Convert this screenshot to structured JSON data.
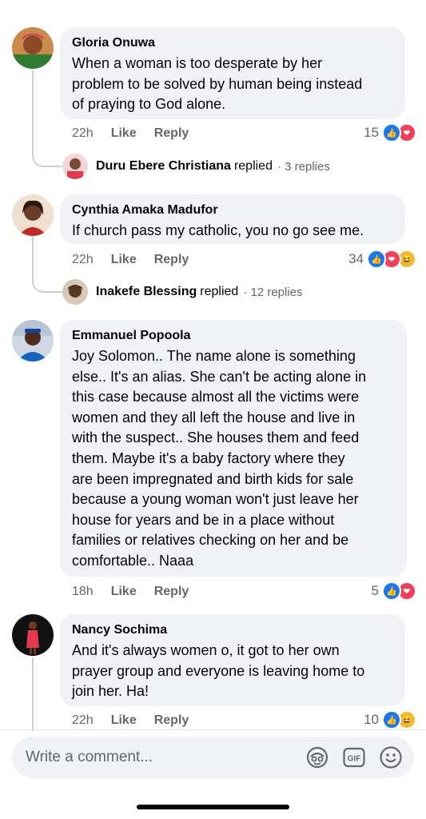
{
  "comments": [
    {
      "author": "Gloria Onuwa",
      "text": "When a woman is too desperate by her\nproblem to be solved by human being instead\nof praying to God alone.",
      "time": "22h",
      "like_label": "Like",
      "reply_label": "Reply",
      "reaction_count": "15",
      "reactions": [
        "like",
        "love"
      ],
      "reply_summary": {
        "name": "Duru Ebere Christiana",
        "verb": "replied",
        "count": "· 3 replies"
      }
    },
    {
      "author": "Cynthia Amaka Madufor",
      "text": "If church pass my catholic, you no go see me.",
      "time": "22h",
      "like_label": "Like",
      "reply_label": "Reply",
      "reaction_count": "34",
      "reactions": [
        "like",
        "love",
        "haha"
      ],
      "reply_summary": {
        "name": "Inakefe Blessing",
        "verb": "replied",
        "count": "· 12 replies"
      }
    },
    {
      "author": "Emmanuel Popoola",
      "text": "Joy Solomon.. The name alone is something\nelse.. It's an alias. She can't be acting alone in\nthis case because almost all the victims were\nwomen and they all left the house and live in\nwith the suspect.. She houses them and feed\nthem. Maybe it's a baby factory where they\nare been impregnated and birth kids for sale\nbecause a young woman won't just leave her\nhouse for years and be in a place without\nfamilies or relatives checking on her and be\ncomfortable.. Naaa",
      "time": "18h",
      "like_label": "Like",
      "reply_label": "Reply",
      "reaction_count": "5",
      "reactions": [
        "like",
        "love"
      ]
    },
    {
      "author": "Nancy Sochima",
      "text": "And it's always women o, it got to her own\nprayer group and everyone is leaving home to\njoin her. Ha!",
      "time": "22h",
      "like_label": "Like",
      "reply_label": "Reply",
      "reaction_count": "10",
      "reactions": [
        "like",
        "haha"
      ]
    }
  ],
  "composer": {
    "placeholder": "Write a comment..."
  },
  "colors": {
    "like": "#1877f2",
    "love": "#f33e58",
    "haha": "#f7b928",
    "bubble": "#f0f2f5",
    "meta": "#65676b"
  }
}
